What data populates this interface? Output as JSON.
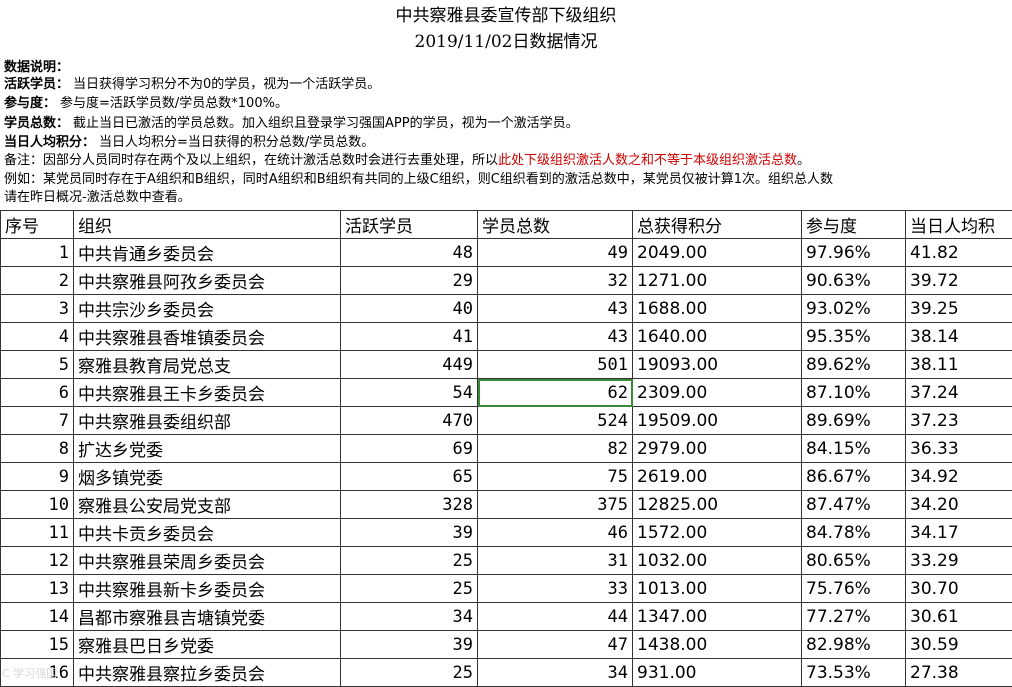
{
  "title": {
    "line1": "中共察雅县委宣传部下级组织",
    "line2": "2019/11/02日数据情况"
  },
  "notes": [
    {
      "key": "数据说明：",
      "text": ""
    },
    {
      "key": "活跃学员：",
      "text": "当日获得学习积分不为0的学员，视为一个活跃学员。"
    },
    {
      "key": "参与度：",
      "text": "参与度=活跃学员数/学员总数*100%。"
    },
    {
      "key": "学员总数：",
      "text": "截止当日已激活的学员总数。加入组织且登录学习强国APP的学员，视为一个激活学员。"
    },
    {
      "key": "当日人均积分：",
      "text": "当日人均积分=当日获得的积分总数/学员总数。"
    }
  ],
  "remark": {
    "prefix": "备注：因部分人员同时存在两个及以上组织，在统计激活总数时会进行去重处理，所以",
    "highlight": "此处下级组织激活人数之和不等于本级组织激活总数",
    "suffix": "。",
    "example_line1": "例如：某党员同时存在于A组织和B组织，同时A组织和B组织有共同的上级C组织，则C组织看到的激活总数中，某党员仅被计算1次。组织总人数",
    "example_line2": "请在昨日概况-激活总数中查看。"
  },
  "table": {
    "headers": [
      "序号",
      "组织",
      "活跃学员",
      "学员总数",
      "总获得积分",
      "参与度",
      "当日人均积"
    ],
    "rows": [
      [
        "1",
        "中共肯通乡委员会",
        "48",
        "49",
        "2049.00",
        "97.96%",
        "41.82"
      ],
      [
        "2",
        "中共察雅县阿孜乡委员会",
        "29",
        "32",
        "1271.00",
        "90.63%",
        "39.72"
      ],
      [
        "3",
        "中共宗沙乡委员会",
        "40",
        "43",
        "1688.00",
        "93.02%",
        "39.25"
      ],
      [
        "4",
        "中共察雅县香堆镇委员会",
        "41",
        "43",
        "1640.00",
        "95.35%",
        "38.14"
      ],
      [
        "5",
        "察雅县教育局党总支",
        "449",
        "501",
        "19093.00",
        "89.62%",
        "38.11"
      ],
      [
        "6",
        "中共察雅县王卡乡委员会",
        "54",
        "62",
        "2309.00",
        "87.10%",
        "37.24"
      ],
      [
        "7",
        "中共察雅县委组织部",
        "470",
        "524",
        "19509.00",
        "89.69%",
        "37.23"
      ],
      [
        "8",
        "扩达乡党委",
        "69",
        "82",
        "2979.00",
        "84.15%",
        "36.33"
      ],
      [
        "9",
        "烟多镇党委",
        "65",
        "75",
        "2619.00",
        "86.67%",
        "34.92"
      ],
      [
        "10",
        "察雅县公安局党支部",
        "328",
        "375",
        "12825.00",
        "87.47%",
        "34.20"
      ],
      [
        "11",
        "中共卡贡乡委员会",
        "39",
        "46",
        "1572.00",
        "84.78%",
        "34.17"
      ],
      [
        "12",
        "中共察雅县荣周乡委员会",
        "25",
        "31",
        "1032.00",
        "80.65%",
        "33.29"
      ],
      [
        "13",
        "中共察雅县新卡乡委员会",
        "25",
        "33",
        "1013.00",
        "75.76%",
        "30.70"
      ],
      [
        "14",
        "昌都市察雅县吉塘镇党委",
        "34",
        "44",
        "1347.00",
        "77.27%",
        "30.61"
      ],
      [
        "15",
        "察雅县巴日乡党委",
        "39",
        "47",
        "1438.00",
        "82.98%",
        "30.59"
      ],
      [
        "16",
        "中共察雅县察拉乡委员会",
        "25",
        "34",
        "931.00",
        "73.53%",
        "27.38"
      ]
    ]
  },
  "watermark": "C 学习强国"
}
